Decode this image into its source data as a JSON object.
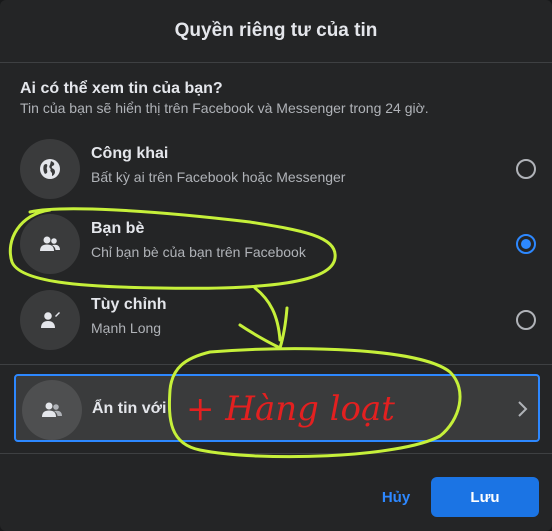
{
  "dialog": {
    "title": "Quyền riêng tư của tin",
    "question": "Ai có thể xem tin của bạn?",
    "hint": "Tin của bạn sẽ hiển thị trên Facebook và Messenger trong 24 giờ."
  },
  "options": [
    {
      "title": "Công khai",
      "subtitle": "Bất kỳ ai trên Facebook hoặc Messenger",
      "icon": "globe-icon",
      "selected": false
    },
    {
      "title": "Bạn bè",
      "subtitle": "Chỉ bạn bè của bạn trên Facebook",
      "icon": "friends-icon",
      "selected": true
    },
    {
      "title": "Tùy chỉnh",
      "subtitle": "Mạnh Long",
      "icon": "custom-user-icon",
      "selected": false
    }
  ],
  "hide_row": {
    "label": "Ẩn tin với",
    "icon": "hide-user-icon"
  },
  "annotation": {
    "text": "+ Hàng loạt"
  },
  "footer": {
    "cancel_label": "Hủy",
    "save_label": "Lưu"
  },
  "colors": {
    "accent": "#2d88ff",
    "save": "#1b74e4",
    "annotation_outline": "#c6f03a",
    "annotation_text": "#e32020"
  }
}
